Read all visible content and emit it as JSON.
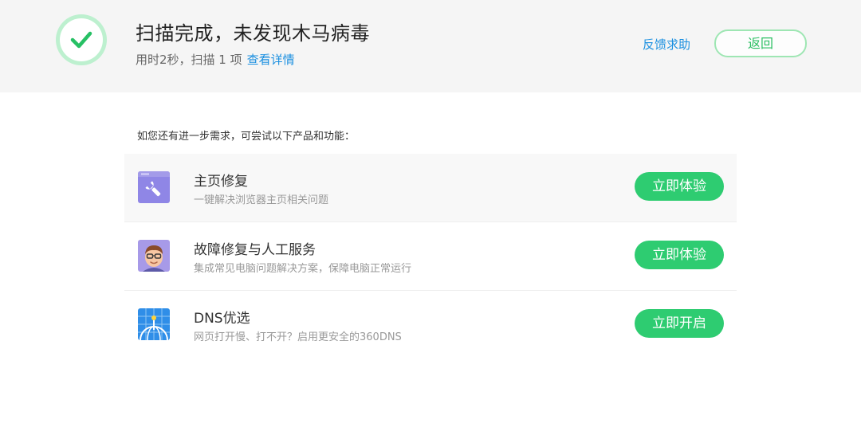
{
  "header": {
    "title": "扫描完成，未发现木马病毒",
    "subtitle_text": "用时2秒，扫描 1 项",
    "details_link": "查看详情",
    "feedback_link": "反馈求助",
    "back_button": "返回",
    "status_icon": "check-icon"
  },
  "intro": "如您还有进一步需求，可尝试以下产品和功能：",
  "products": [
    {
      "name": "主页修复",
      "description": "一键解决浏览器主页相关问题",
      "button": "立即体验",
      "icon": "wrench-icon",
      "icon_color": "#8f86e6"
    },
    {
      "name": "故障修复与人工服务",
      "description": "集成常见电脑问题解决方案，保障电脑正常运行",
      "button": "立即体验",
      "icon": "technician-avatar-icon",
      "icon_color": "#a79ae8"
    },
    {
      "name": "DNS优选",
      "description": "网页打开慢、打不开？启用更安全的360DNS",
      "button": "立即开启",
      "icon": "globe-network-icon",
      "icon_color": "#2f8ee8"
    }
  ],
  "colors": {
    "accent_green": "#2ecc71",
    "link_blue": "#1a8fe0",
    "header_bg": "#f5f5f5"
  }
}
